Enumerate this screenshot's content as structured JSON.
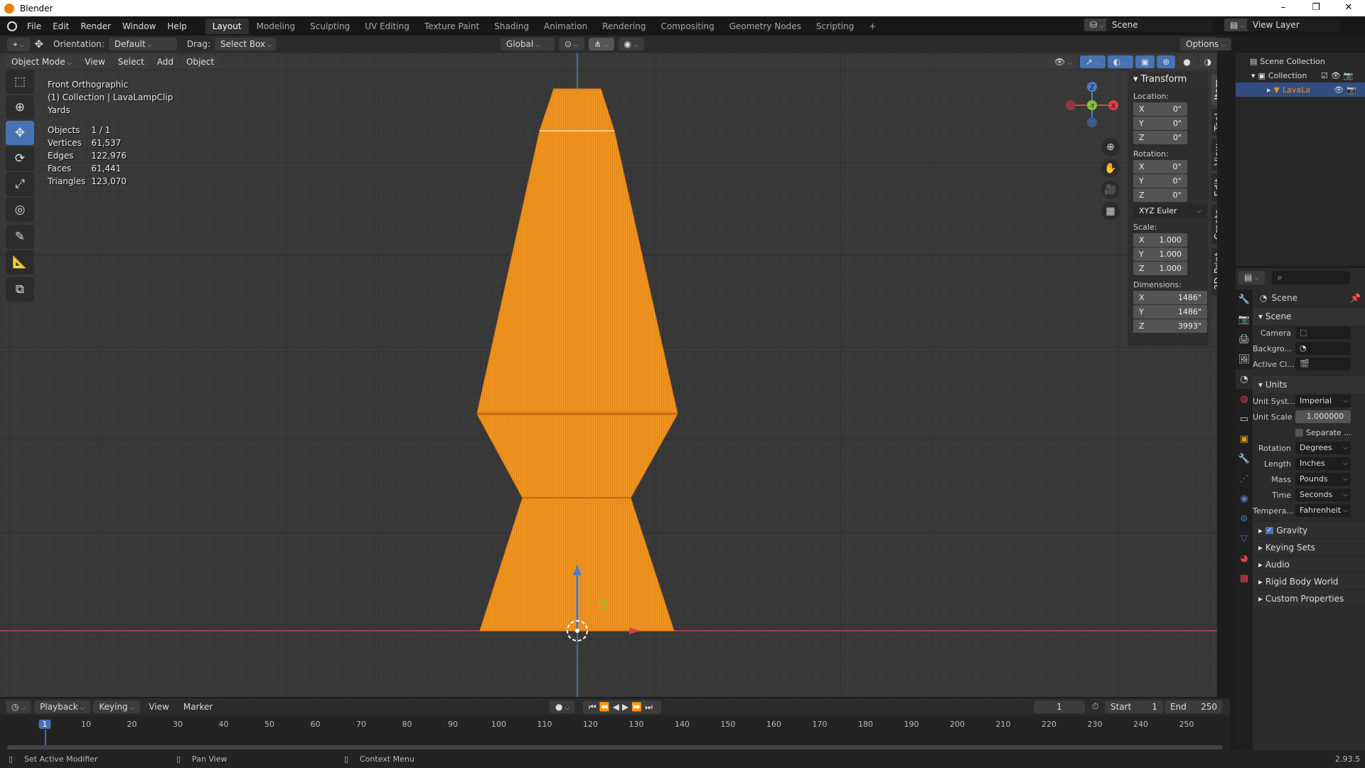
{
  "window": {
    "title": "Blender",
    "controls": [
      "–",
      "❐",
      "✕"
    ]
  },
  "menu": [
    "File",
    "Edit",
    "Render",
    "Window",
    "Help"
  ],
  "workspaces": [
    "Layout",
    "Modeling",
    "Sculpting",
    "UV Editing",
    "Texture Paint",
    "Shading",
    "Animation",
    "Rendering",
    "Compositing",
    "Geometry Nodes",
    "Scripting",
    "+"
  ],
  "active_workspace": "Layout",
  "scene_selector": "Scene",
  "view_layer": "View Layer",
  "header": {
    "orientation_label": "Orientation:",
    "orientation_value": "Default",
    "drag_label": "Drag:",
    "drag_value": "Select Box",
    "transform_orientation": "Global",
    "options": "Options"
  },
  "viewport_header": {
    "mode": "Object Mode",
    "menus": [
      "View",
      "Select",
      "Add",
      "Object"
    ]
  },
  "overlay_info": {
    "view": "Front Orthographic",
    "collection": "(1) Collection | LavaLampClip",
    "units": "Yards",
    "stats": [
      {
        "k": "Objects",
        "v": "1 / 1"
      },
      {
        "k": "Vertices",
        "v": "61,537"
      },
      {
        "k": "Edges",
        "v": "122,976"
      },
      {
        "k": "Faces",
        "v": "61,441"
      },
      {
        "k": "Triangles",
        "v": "123,070"
      }
    ]
  },
  "gizmo": {
    "z": "Z",
    "y": "-Y",
    "x": "X"
  },
  "transform": {
    "title": "Transform",
    "location_label": "Location:",
    "location": [
      {
        "a": "X",
        "v": "0\""
      },
      {
        "a": "Y",
        "v": "0\""
      },
      {
        "a": "Z",
        "v": "0\""
      }
    ],
    "rotation_label": "Rotation:",
    "rotation": [
      {
        "a": "X",
        "v": "0°"
      },
      {
        "a": "Y",
        "v": "0°"
      },
      {
        "a": "Z",
        "v": "0°"
      }
    ],
    "rotation_mode": "XYZ Euler",
    "scale_label": "Scale:",
    "scale": [
      {
        "a": "X",
        "v": "1.000"
      },
      {
        "a": "Y",
        "v": "1.000"
      },
      {
        "a": "Z",
        "v": "1.000"
      }
    ],
    "dimensions_label": "Dimensions:",
    "dimensions": [
      {
        "a": "X",
        "v": "1486\""
      },
      {
        "a": "Y",
        "v": "1486\""
      },
      {
        "a": "Z",
        "v": "3993\""
      }
    ]
  },
  "n_tabs": [
    "Item",
    "Tool",
    "View",
    "Edit",
    "Create",
    "3D-Print"
  ],
  "outliner": {
    "root": "Scene Collection",
    "collection": "Collection",
    "object": "LavaLa"
  },
  "properties": {
    "context": "Scene",
    "scene_section": "Scene",
    "camera_label": "Camera",
    "background_label": "Backgro...",
    "active_clip_label": "Active Cl...",
    "units_section": "Units",
    "unit_system_label": "Unit Syst...",
    "unit_system": "Imperial",
    "unit_scale_label": "Unit Scale",
    "unit_scale": "1.000000",
    "separate": "Separate ...",
    "rotation_label": "Rotation",
    "rotation": "Degrees",
    "length_label": "Length",
    "length": "Inches",
    "mass_label": "Mass",
    "mass": "Pounds",
    "time_label": "Time",
    "time": "Seconds",
    "temperature_label": "Tempera...",
    "temperature": "Fahrenheit",
    "collapsed": [
      "Gravity",
      "Keying Sets",
      "Audio",
      "Rigid Body World",
      "Custom Properties"
    ],
    "gravity_checked": true
  },
  "timeline": {
    "menus": [
      "Playback",
      "Keying",
      "View",
      "Marker"
    ],
    "current_frame": "1",
    "start_label": "Start",
    "start": "1",
    "end_label": "End",
    "end": "250",
    "ticks": [
      "1",
      "10",
      "20",
      "30",
      "40",
      "50",
      "60",
      "70",
      "80",
      "90",
      "100",
      "110",
      "120",
      "130",
      "140",
      "150",
      "160",
      "170",
      "180",
      "190",
      "200",
      "210",
      "220",
      "230",
      "240",
      "250"
    ]
  },
  "status": {
    "left": "Set Active Modifier",
    "middle": "Pan View",
    "right": "Context Menu",
    "version": "2.93.5"
  },
  "colors": {
    "accent": "#4772b3",
    "object": "#e8911f",
    "x_axis": "#d9414b",
    "y_axis": "#8ac43a",
    "z_axis": "#4f7cc6"
  }
}
